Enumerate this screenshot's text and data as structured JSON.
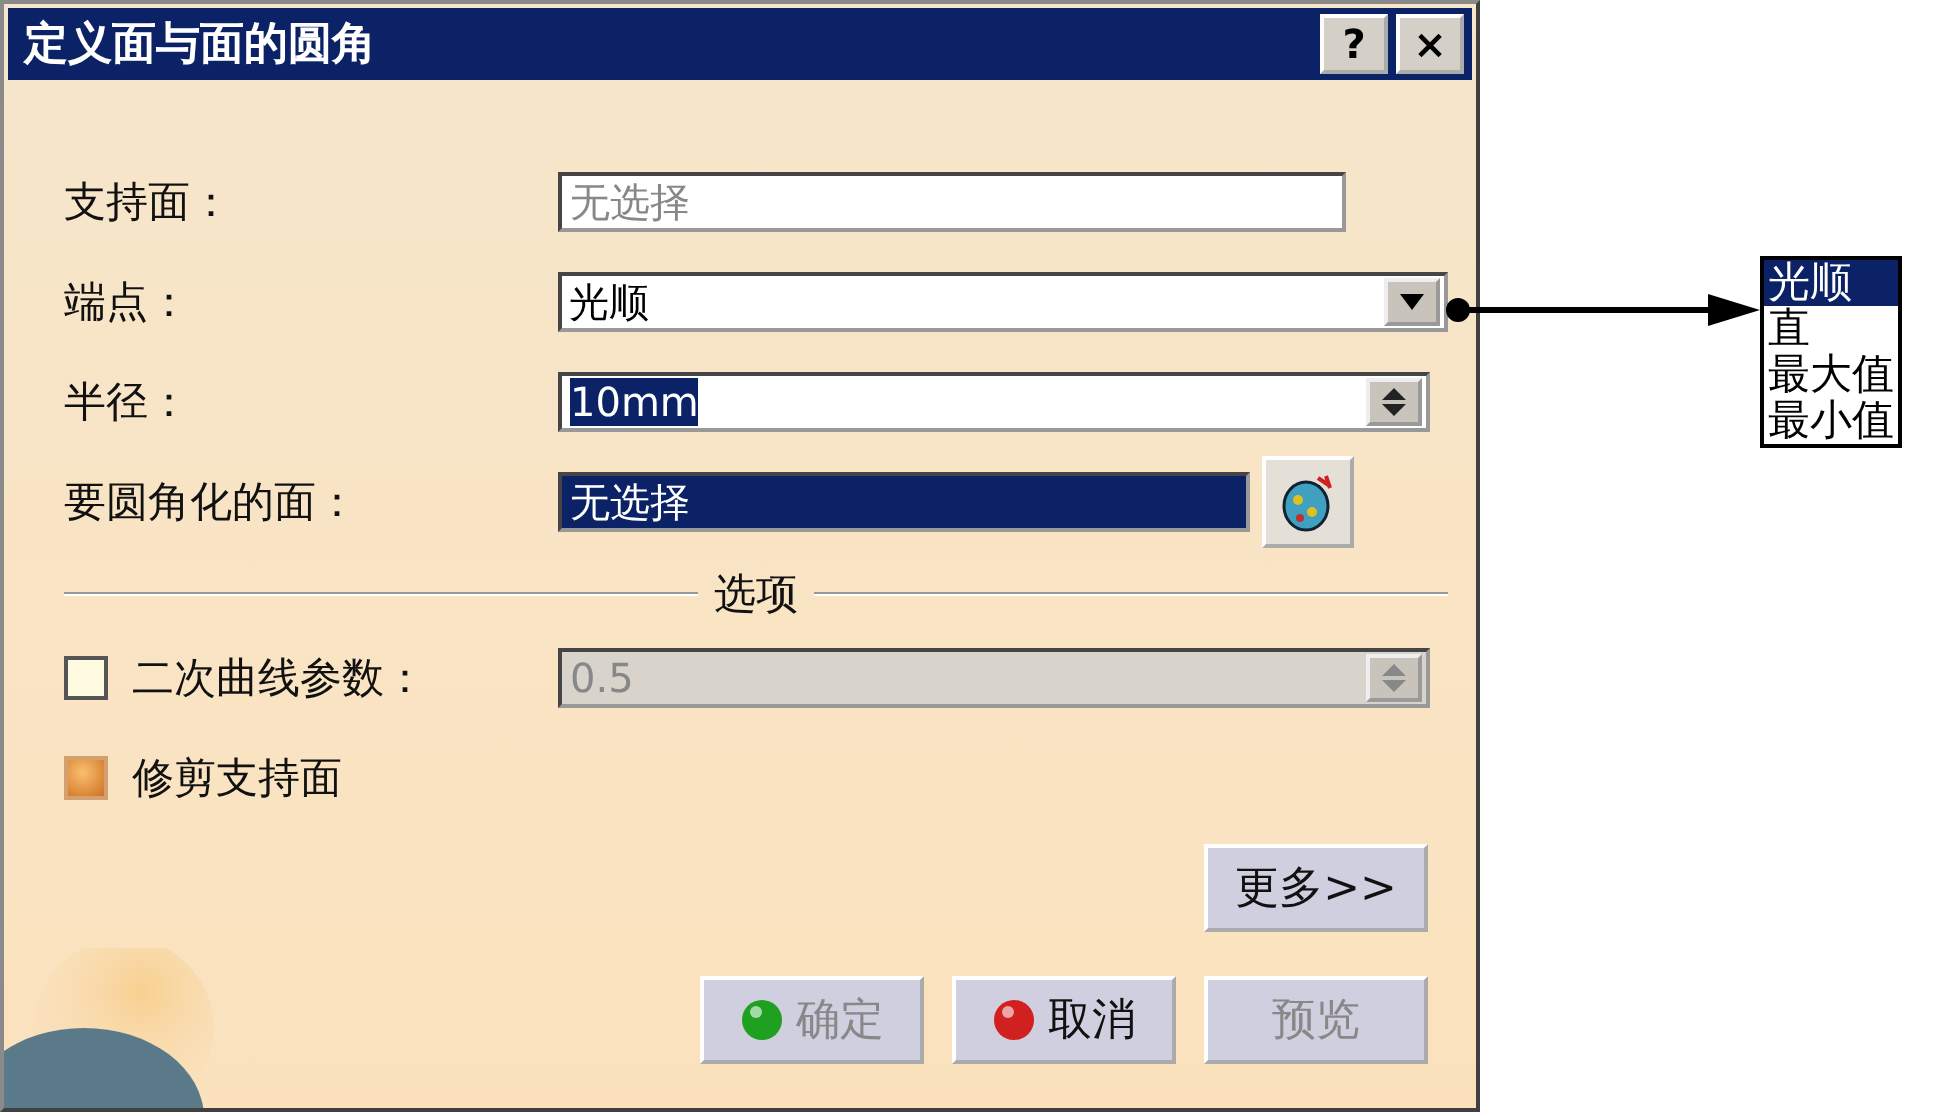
{
  "window": {
    "title": "定义面与面的圆角",
    "title_buttons": [
      "?",
      "×"
    ]
  },
  "fields": [
    {
      "kind": "text",
      "label": "支持面：",
      "placeholder": "无选择",
      "selected": false
    },
    {
      "kind": "combo",
      "label": "端点：",
      "value": "光顺",
      "selected": false
    },
    {
      "kind": "spin",
      "label": "半径：",
      "value": "10mm",
      "selected": true
    },
    {
      "kind": "selector",
      "label": "要圆角化的面：",
      "value": "无选择",
      "selected": true
    }
  ],
  "options": {
    "title": "选项",
    "items": [
      {
        "kind": "spin",
        "label": "二次曲线参数：",
        "checked": false,
        "value": "0.5"
      },
      {
        "kind": "check",
        "label": "修剪支持面",
        "checked": true
      }
    ]
  },
  "more_button": "更多>>",
  "buttons": [
    {
      "kind": "ok",
      "label": "确定",
      "disabled": true
    },
    {
      "kind": "cancel",
      "label": "取消",
      "disabled": false
    },
    {
      "kind": "plain",
      "label": "预览",
      "disabled": true
    }
  ],
  "dropdown_list": [
    {
      "label": "光顺",
      "selected": true
    },
    {
      "label": "直",
      "selected": false
    },
    {
      "label": "最大值",
      "selected": false
    },
    {
      "label": "最小值",
      "selected": false
    }
  ]
}
